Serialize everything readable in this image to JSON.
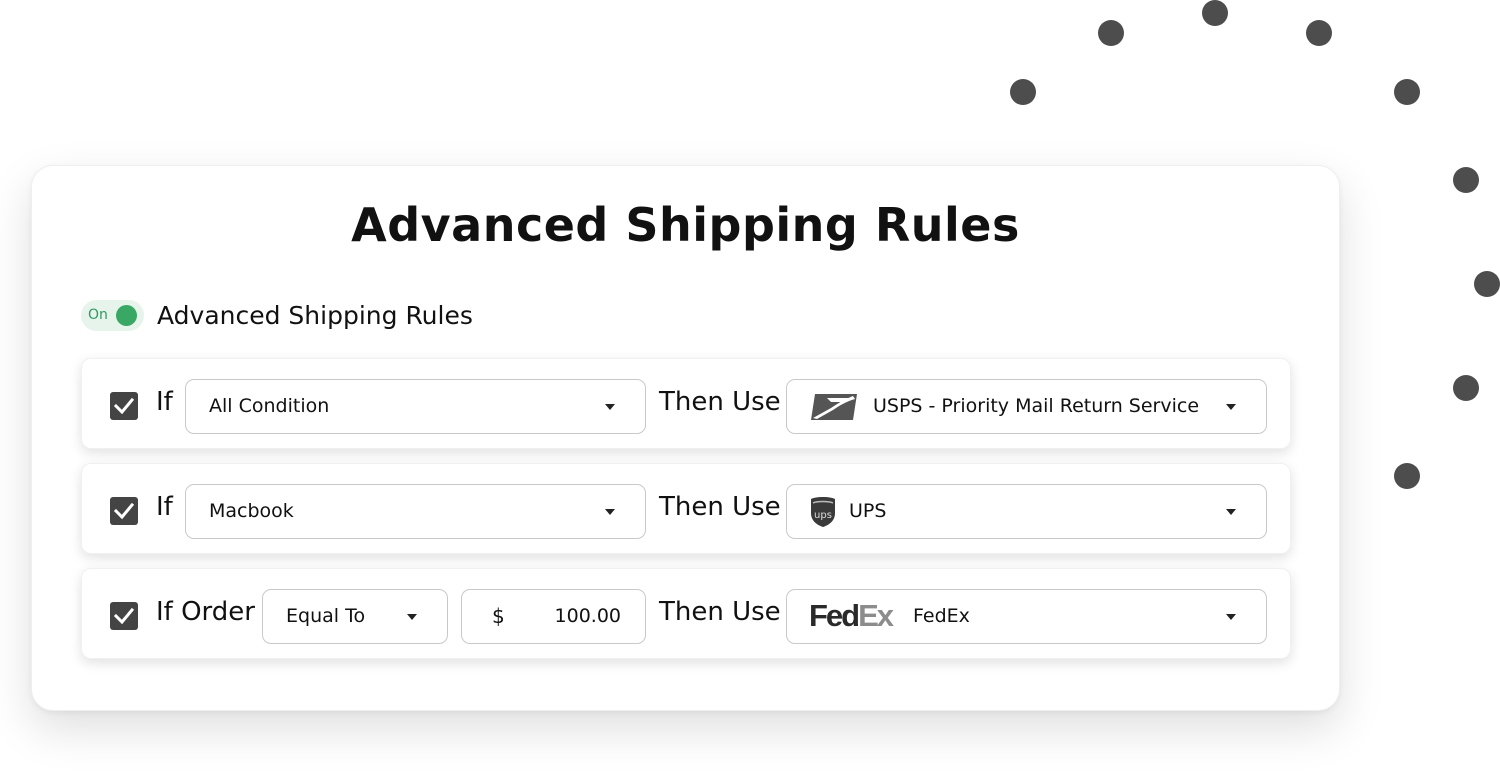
{
  "card": {
    "title": "Advanced Shipping Rules",
    "toggle": {
      "state_label": "On",
      "label": "Advanced Shipping Rules",
      "enabled": true
    }
  },
  "rules": [
    {
      "checked": true,
      "if_label": "If",
      "condition": "All Condition",
      "then_label": "Then Use",
      "carrier": {
        "icon": "usps-eagle-icon",
        "name": "USPS - Priority Mail Return Service"
      }
    },
    {
      "checked": true,
      "if_label": "If",
      "condition": "Macbook",
      "then_label": "Then Use",
      "carrier": {
        "icon": "ups-shield-icon",
        "name": "UPS"
      }
    },
    {
      "checked": true,
      "if_label": "If Order",
      "operator": "Equal To",
      "currency": "$",
      "amount": "100.00",
      "then_label": "Then Use",
      "carrier": {
        "icon": "fedex-logo-icon",
        "logo_text": [
          "Fed",
          "Ex"
        ],
        "name": "FedEx"
      }
    }
  ],
  "colors": {
    "toggle_on": "#3aa865",
    "toggle_bg": "#e6f4ec",
    "checkbox": "#444444",
    "dots": "#4d4d4d"
  }
}
